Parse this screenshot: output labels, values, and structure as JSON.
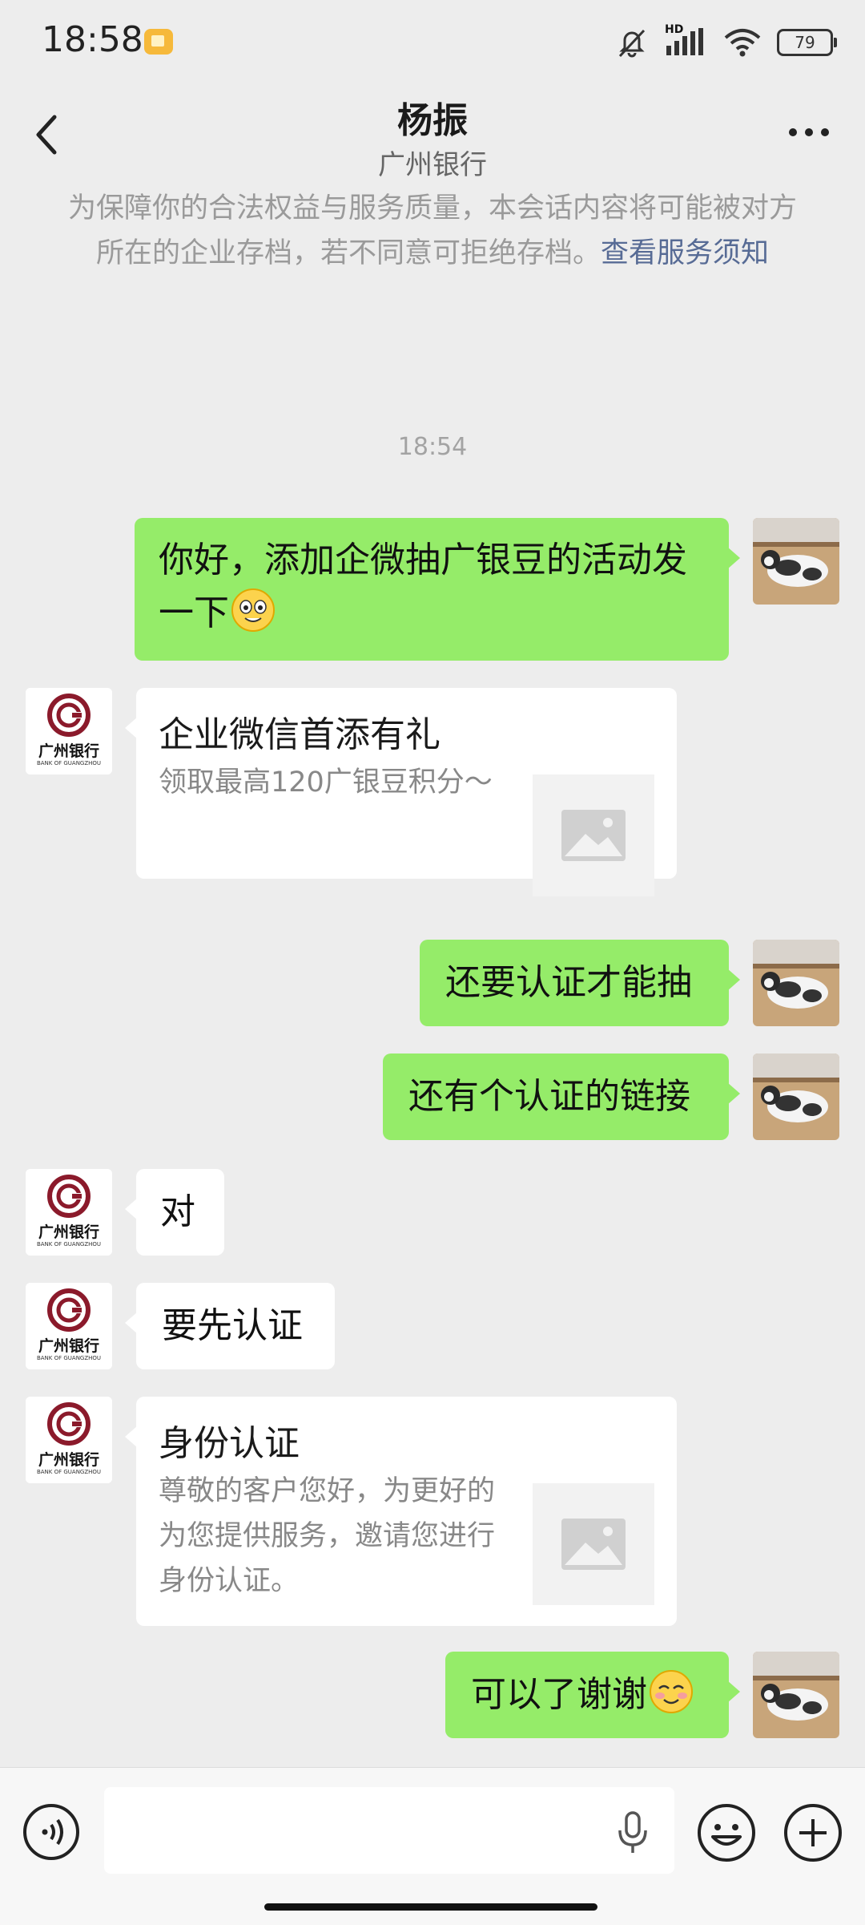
{
  "status_bar": {
    "time": "18:58",
    "network_label": "HD",
    "battery": "79",
    "icons": [
      "app-notification-icon",
      "mute-icon",
      "signal-icon",
      "wifi-icon",
      "battery-icon"
    ]
  },
  "header": {
    "title": "杨振",
    "subtitle": "广州银行",
    "icons": [
      "back-icon",
      "more-icon"
    ]
  },
  "notice": {
    "text": "为保障你的合法权益与服务质量，本会话内容将可能被对方所在的企业存档，若不同意可拒绝存档。",
    "link": "查看服务须知"
  },
  "timestamp": "18:54",
  "messages": [
    {
      "from": "me",
      "text": "你好，添加企微抽广银豆的活动发一下",
      "emoji": "grinning-face"
    },
    {
      "from": "bank",
      "type": "card",
      "title": "企业微信首添有礼",
      "desc": "领取最高120广银豆积分～"
    },
    {
      "from": "me",
      "text": "还要认证才能抽"
    },
    {
      "from": "me",
      "text": "还有个认证的链接"
    },
    {
      "from": "bank",
      "text": "对"
    },
    {
      "from": "bank",
      "text": "要先认证"
    },
    {
      "from": "bank",
      "type": "card",
      "title": "身份认证",
      "desc": "尊敬的客户您好，为更好的为您提供服务，邀请您进行身份认证。"
    },
    {
      "from": "me",
      "text": "可以了谢谢",
      "emoji": "smiling-face"
    }
  ],
  "bank_avatar": {
    "name": "广州银行",
    "english": "BANK OF GUANGZHOU",
    "color": "#8b1a2b"
  },
  "input": {
    "value": "",
    "icons": [
      "voice-icon",
      "microphone-icon",
      "emoji-icon",
      "plus-icon"
    ]
  },
  "colors": {
    "my_bubble": "#95ec69",
    "their_bubble": "#ffffff",
    "link": "#576b95",
    "background": "#ededed"
  }
}
